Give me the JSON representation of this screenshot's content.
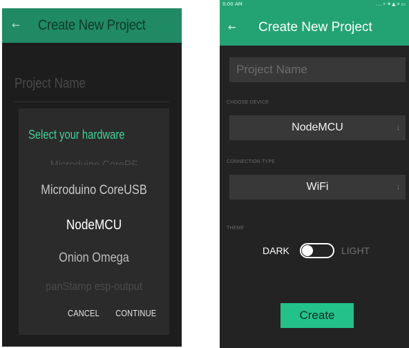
{
  "left_screen": {
    "appbar": {
      "back_glyph": "←",
      "title": "Create New Project"
    },
    "background": {
      "project_name_placeholder": "Project Name"
    },
    "dialog": {
      "title": "Select your hardware",
      "options": [
        "Microduino CoreRF",
        "Microduino CoreUSB",
        "NodeMCU",
        "Onion Omega",
        "panStamp esp-output"
      ],
      "selected_option": "NodeMCU",
      "cancel_label": "CANCEL",
      "continue_label": "CONTINUE"
    }
  },
  "right_screen": {
    "status_bar": {
      "time": "0:00 AM",
      "icons": "...⚬✈▲⚪▭"
    },
    "appbar": {
      "back_glyph": "←",
      "title": "Create New Project"
    },
    "project_name_placeholder": "Project Name",
    "choose_device": {
      "label": "CHOOSE DEVICE",
      "value": "NodeMCU",
      "arrow": "↓"
    },
    "connection_type": {
      "label": "CONNECTION TYPE",
      "value": "WiFi",
      "arrow": "↓"
    },
    "theme": {
      "label": "THEME",
      "dark_label": "DARK",
      "light_label": "LIGHT",
      "selected": "DARK"
    },
    "create_label": "Create"
  },
  "colors": {
    "brand_green": "#23a374",
    "accent_green": "#3fd39a",
    "button_green": "#23c28b",
    "background_dark": "#232323"
  },
  "icons": [
    "back-arrow-icon",
    "dropdown-arrow-icon",
    "toggle-switch"
  ]
}
